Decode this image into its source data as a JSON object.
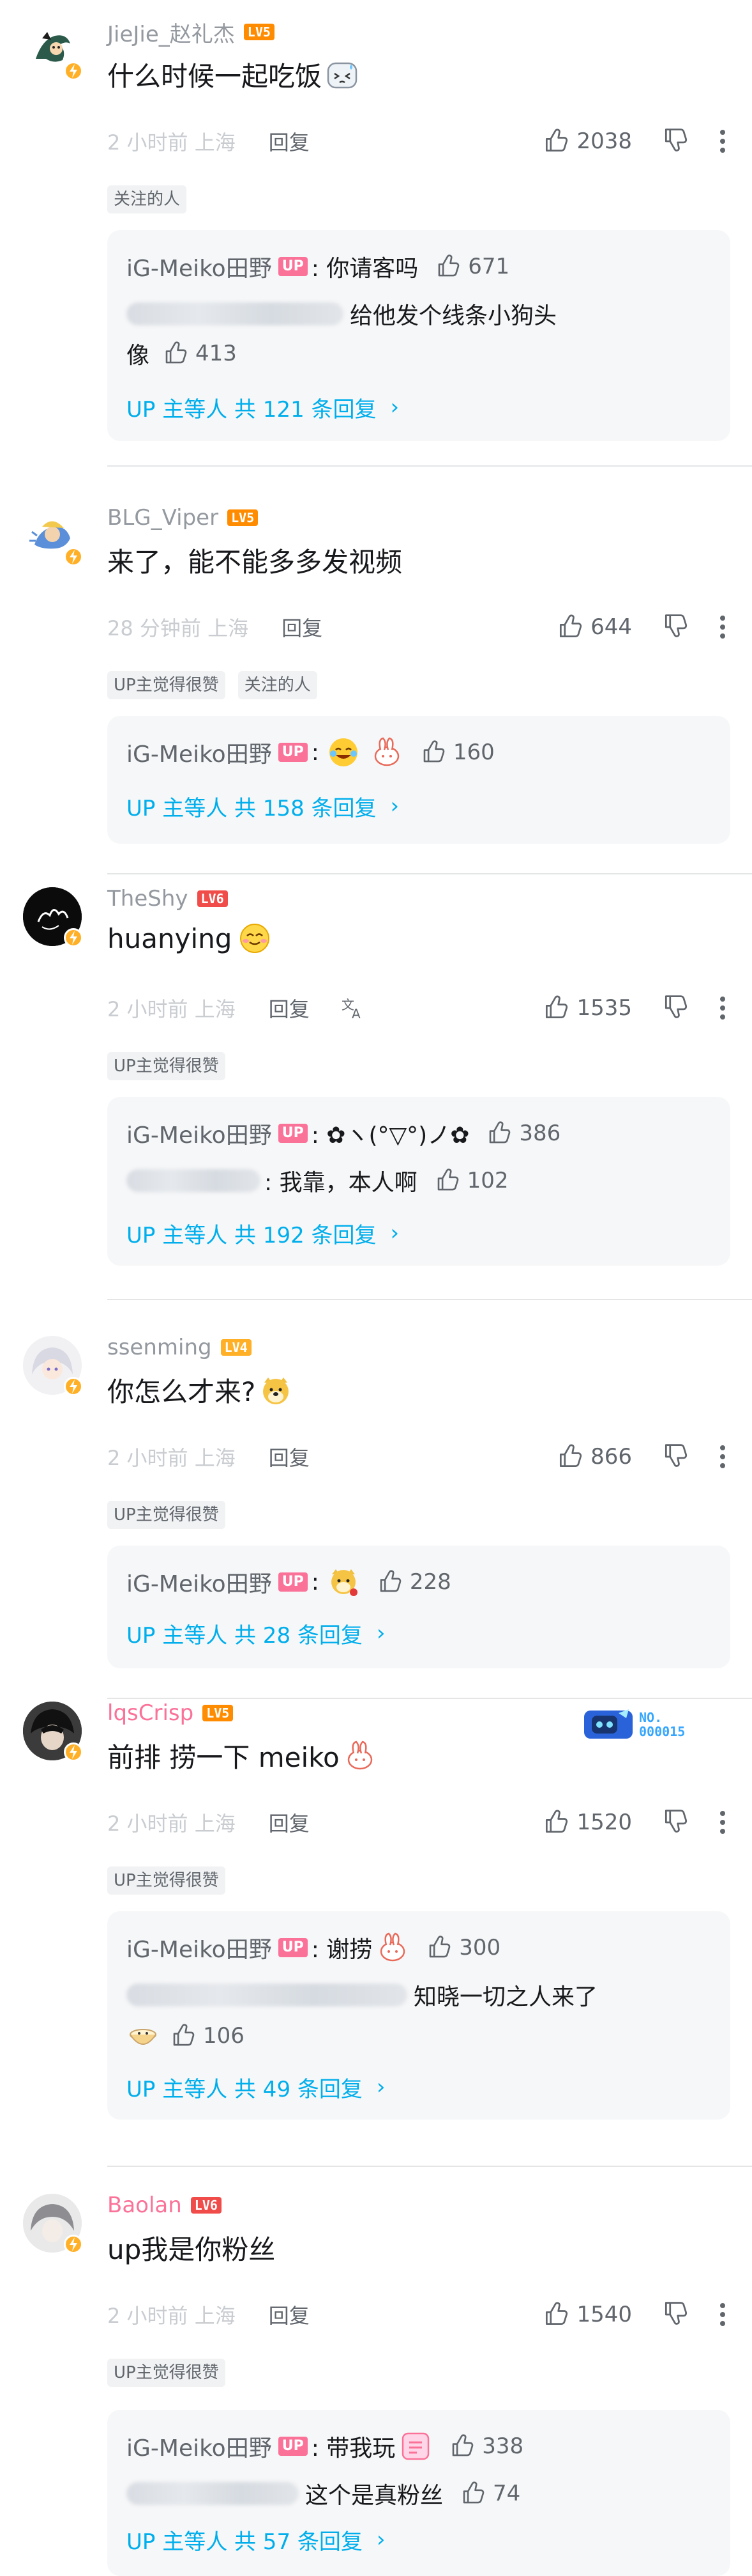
{
  "comments": [
    {
      "username": "JieJie_赵礼杰",
      "level": "LV5",
      "text": "什么时候一起吃饭",
      "time": "2 小时前 上海",
      "reply_label": "回复",
      "likes": "2038",
      "tags": [
        "关注的人"
      ],
      "replies": [
        {
          "name": "iG-Meiko田野",
          "up": "UP",
          "text": ": 你请客吗",
          "likes": "671"
        },
        {
          "text_a": "给他发个线条小狗头",
          "text_b": "像",
          "likes": "413"
        }
      ],
      "more": "UP 主等人 共 121 条回复"
    },
    {
      "username": "BLG_Viper",
      "level": "LV5",
      "text": "来了，能不能多多发视频",
      "time": "28 分钟前 上海",
      "reply_label": "回复",
      "likes": "644",
      "tags": [
        "UP主觉得很赞",
        "关注的人"
      ],
      "replies": [
        {
          "name": "iG-Meiko田野",
          "up": "UP",
          "text": ":",
          "likes": "160"
        }
      ],
      "more": "UP 主等人 共 158 条回复"
    },
    {
      "username": "TheShy",
      "level": "LV6",
      "text": "huanying",
      "time": "2 小时前 上海",
      "reply_label": "回复",
      "likes": "1535",
      "tags": [
        "UP主觉得很赞"
      ],
      "replies": [
        {
          "name": "iG-Meiko田野",
          "up": "UP",
          "text": ": ✿ヽ(°▽°)ノ✿",
          "likes": "386"
        },
        {
          "text": ": 我靠，本人啊",
          "likes": "102"
        }
      ],
      "more": "UP 主等人 共 192 条回复"
    },
    {
      "username": "ssenming",
      "level": "LV4",
      "text": "你怎么才来?",
      "time": "2 小时前 上海",
      "reply_label": "回复",
      "likes": "866",
      "tags": [
        "UP主觉得很赞"
      ],
      "replies": [
        {
          "name": "iG-Meiko田野",
          "up": "UP",
          "text": ":",
          "likes": "228"
        }
      ],
      "more": "UP 主等人 共 28 条回复"
    },
    {
      "username": "lqsCrisp",
      "level": "LV5",
      "text": "前排 捞一下 meiko",
      "time": "2 小时前 上海",
      "reply_label": "回复",
      "likes": "1520",
      "tags": [
        "UP主觉得很赞"
      ],
      "medal": {
        "line1": "NO.",
        "line2": "000015"
      },
      "replies": [
        {
          "name": "iG-Meiko田野",
          "up": "UP",
          "text": ": 谢捞",
          "likes": "300"
        },
        {
          "text_a": "知晓一切之人来了",
          "likes": "106"
        }
      ],
      "more": "UP 主等人 共 49 条回复"
    },
    {
      "username": "Baolan",
      "level": "LV6",
      "text": "up我是你粉丝",
      "time": "2 小时前 上海",
      "reply_label": "回复",
      "likes": "1540",
      "tags": [
        "UP主觉得很赞"
      ],
      "replies": [
        {
          "name": "iG-Meiko田野",
          "up": "UP",
          "text": ": 带我玩",
          "likes": "338"
        },
        {
          "text": "这个是真粉丝",
          "likes": "74"
        }
      ],
      "more": "UP 主等人 共 57 条回复"
    }
  ],
  "colors": {
    "link": "#00aeec",
    "vip_name": "#fb7299",
    "up_badge": "#fb7299"
  }
}
